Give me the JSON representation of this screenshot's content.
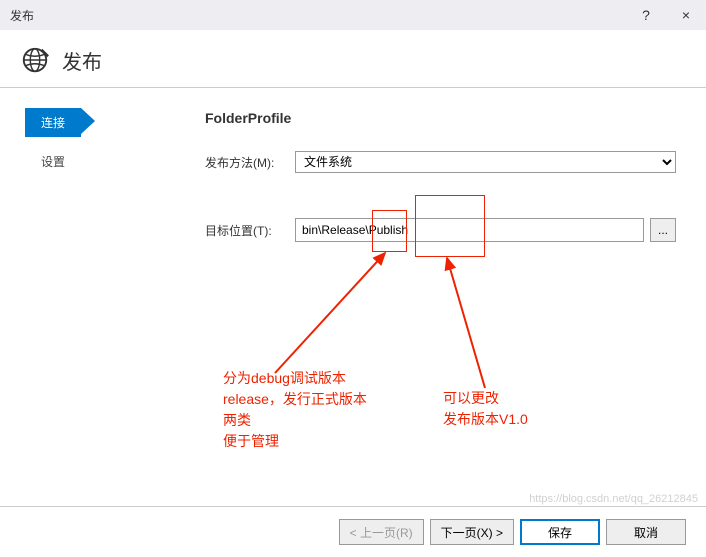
{
  "window": {
    "title": "发布",
    "help": "?",
    "close": "×"
  },
  "header": {
    "title": "发布"
  },
  "sidebar": {
    "tabs": [
      {
        "label": "连接",
        "active": true
      },
      {
        "label": "设置",
        "active": false
      }
    ]
  },
  "content": {
    "profile_title": "FolderProfile",
    "publish_method_label": "发布方法(M):",
    "publish_method_value": "文件系统",
    "target_location_label": "目标位置(T):",
    "target_location_value": "bin\\Release\\Publish",
    "browse_label": "..."
  },
  "annotations": {
    "note1_line1": "分为debug调试版本",
    "note1_line2": "release，发行正式版本",
    "note1_line3": "两类",
    "note1_line4": "便于管理",
    "note2_line1": "可以更改",
    "note2_line2": "发布版本V1.0"
  },
  "footer": {
    "prev": "< 上一页(R)",
    "next": "下一页(X) >",
    "save": "保存",
    "cancel": "取消"
  },
  "watermark": "https://blog.csdn.net/qq_26212845"
}
